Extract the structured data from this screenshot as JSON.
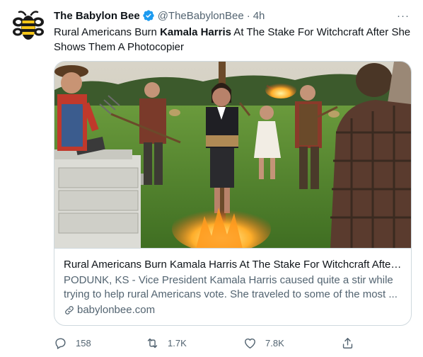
{
  "tweet": {
    "author_name": "The Babylon Bee",
    "handle": "@TheBabylonBee",
    "separator": "·",
    "time": "4h",
    "more_label": "···",
    "text_before": "Rural Americans Burn ",
    "text_bold": "Kamala Harris",
    "text_after": " At The Stake For Witchcraft After She Shows Them A Photocopier"
  },
  "card": {
    "title": "Rural Americans Burn Kamala Harris At The Stake For Witchcraft After ...",
    "description": "PODUNK, KS - Vice President Kamala Harris caused quite a stir while trying to help rural Americans vote. She traveled to some of the most ...",
    "domain": "babylonbee.com"
  },
  "actions": {
    "replies": "158",
    "retweets": "1.7K",
    "likes": "7.8K"
  },
  "icons": {
    "avatar": "bee-logo-icon",
    "verified": "verified-badge-icon",
    "link": "link-icon",
    "reply": "reply-icon",
    "retweet": "retweet-icon",
    "like": "heart-icon",
    "share": "share-icon"
  },
  "colors": {
    "text_primary": "#0f1419",
    "text_secondary": "#536471",
    "verified_blue": "#1d9bf0",
    "border": "#cfd9de",
    "logo_dark": "#1a1a1a"
  }
}
